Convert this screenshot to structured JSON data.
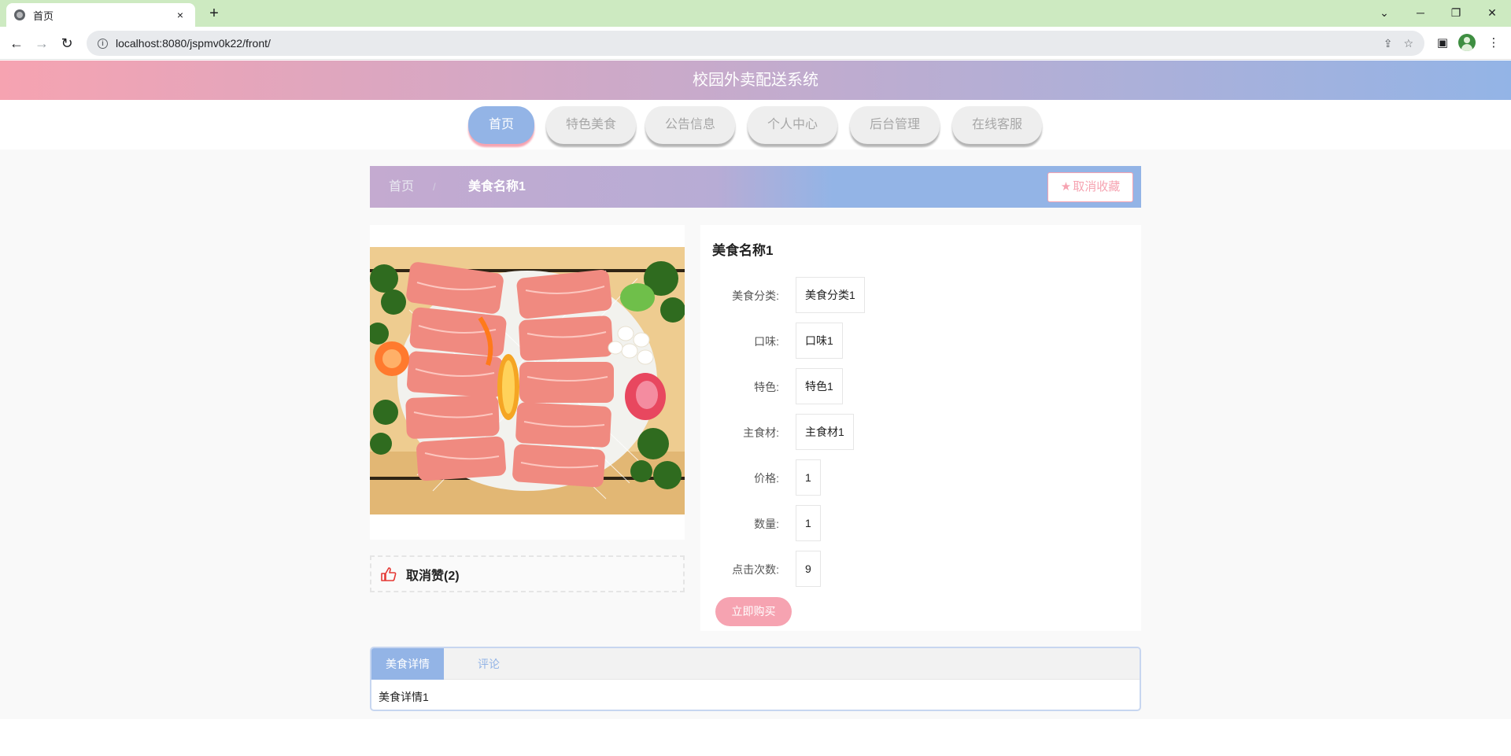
{
  "browser": {
    "tab_title": "首页",
    "tab_close": "×",
    "new_tab": "+",
    "url": "localhost:8080/jspmv0k22/front/"
  },
  "site": {
    "title": "校园外卖配送系统"
  },
  "nav": {
    "items": [
      {
        "label": "首页",
        "active": true
      },
      {
        "label": "特色美食",
        "active": false
      },
      {
        "label": "公告信息",
        "active": false
      },
      {
        "label": "个人中心",
        "active": false
      },
      {
        "label": "后台管理",
        "active": false
      },
      {
        "label": "在线客服",
        "active": false
      }
    ]
  },
  "breadcrumb": {
    "home": "首页",
    "separator": "/",
    "current": "美食名称1"
  },
  "favorite_button": {
    "label": "取消收藏",
    "icon": "star-icon"
  },
  "like": {
    "label": "取消赞(2)",
    "icon": "thumbs-up-icon"
  },
  "product": {
    "name": "美食名称1",
    "fields": [
      {
        "label": "美食分类:",
        "value": "美食分类1"
      },
      {
        "label": "口味:",
        "value": "口味1"
      },
      {
        "label": "特色:",
        "value": "特色1"
      },
      {
        "label": "主食材:",
        "value": "主食材1"
      },
      {
        "label": "价格:",
        "value": "1"
      },
      {
        "label": "数量:",
        "value": "1"
      },
      {
        "label": "点击次数:",
        "value": "9"
      }
    ],
    "buy_label": "立即购买"
  },
  "tabs": {
    "items": [
      {
        "label": "美食详情",
        "active": true
      },
      {
        "label": "评论",
        "active": false
      }
    ],
    "detail_text": "美食详情1"
  },
  "colors": {
    "pink": "#f6a3b1",
    "blue": "#93b4e6",
    "tabstrip": "#cdeac1"
  }
}
